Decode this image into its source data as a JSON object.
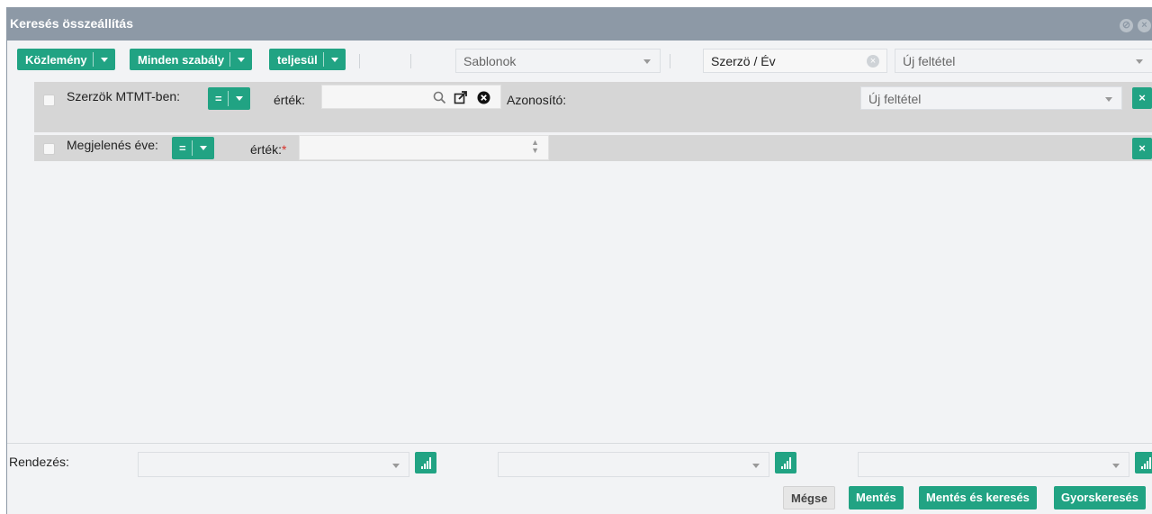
{
  "window": {
    "title": "Keresés összeállítás"
  },
  "toolbar": {
    "type_button": "Közlemény",
    "rule_button": "Minden szabály",
    "condition_button": "teljesül",
    "templates_placeholder": "Sablonok",
    "saved_value": "Szerzö / Év",
    "new_condition_placeholder": "Új feltétel"
  },
  "rows": [
    {
      "label": "Szerzök MTMT-ben:",
      "operator": "=",
      "value_label": "érték:",
      "identifier_label": "Azonosító:",
      "new_condition_placeholder": "Új feltétel",
      "remove": "×"
    },
    {
      "label": "Megjelenés éve:",
      "operator": "=",
      "value_label": "érték:",
      "required_mark": "*",
      "remove": "×"
    }
  ],
  "sort": {
    "label": "Rendezés:"
  },
  "footer": {
    "cancel": "Mégse",
    "save": "Mentés",
    "save_search": "Mentés és keresés",
    "quick_search": "Gyorskeresés"
  },
  "colors": {
    "accent": "#21a383",
    "titlebar": "#8d99a6",
    "row_bg": "#d6d6d6",
    "required": "#d9322b"
  }
}
